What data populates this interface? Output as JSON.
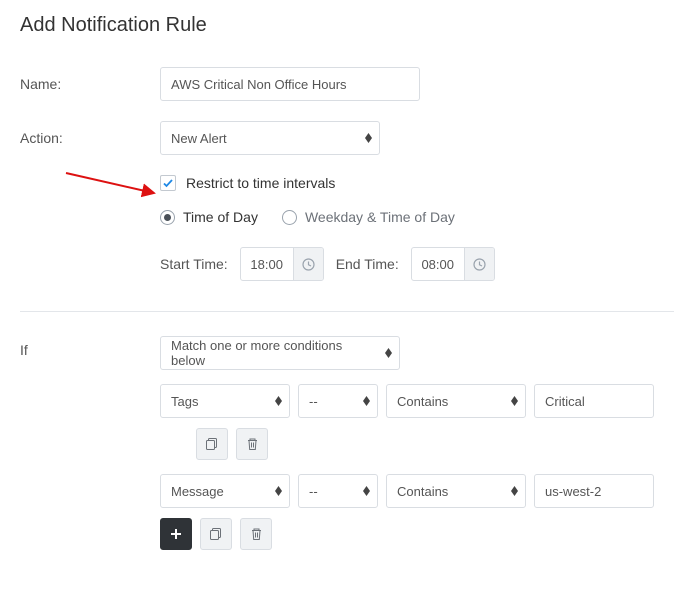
{
  "title": "Add Notification Rule",
  "labels": {
    "name": "Name:",
    "action": "Action:",
    "if": "If",
    "startTime": "Start Time:",
    "endTime": "End Time:"
  },
  "form": {
    "name": "AWS Critical Non Office Hours",
    "action": "New Alert",
    "restrict": {
      "checked": true,
      "label": "Restrict to time intervals",
      "mode": "timeOfDay",
      "options": {
        "timeOfDay": "Time of Day",
        "weekday": "Weekday & Time of Day"
      },
      "startTime": "18:00",
      "endTime": "08:00"
    }
  },
  "if": {
    "matchMode": "Match one or more conditions below",
    "conditions": [
      {
        "field": "Tags",
        "not": "--",
        "operator": "Contains",
        "value": "Critical"
      },
      {
        "field": "Message",
        "not": "--",
        "operator": "Contains",
        "value": "us-west-2"
      }
    ]
  }
}
